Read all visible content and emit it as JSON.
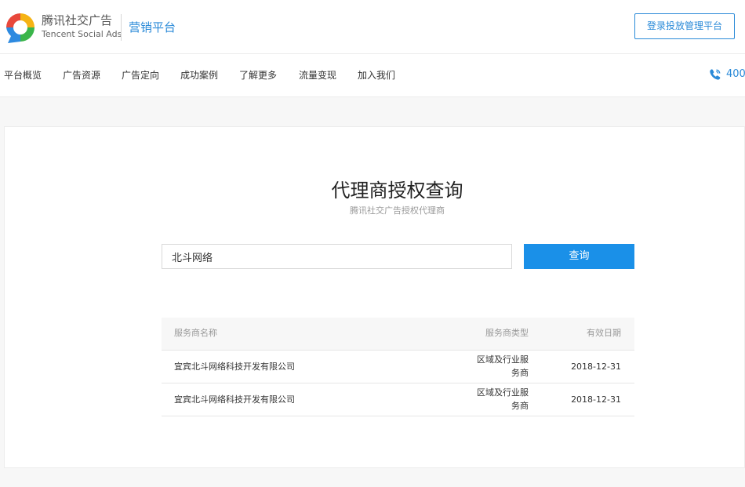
{
  "header": {
    "brand_cn": "腾讯社交广告",
    "brand_en": "Tencent Social Ads",
    "platform": "营销平台",
    "login_button": "登录投放管理平台"
  },
  "nav": {
    "items": [
      "平台概览",
      "广告资源",
      "广告定向",
      "成功案例",
      "了解更多",
      "流量变现",
      "加入我们"
    ],
    "phone": "400-"
  },
  "main": {
    "title": "代理商授权查询",
    "subtitle": "腾讯社交广告授权代理商",
    "search": {
      "value": "北斗网络",
      "placeholder": ""
    },
    "search_button": "查询",
    "table": {
      "headers": {
        "name": "服务商名称",
        "type": "服务商类型",
        "date": "有效日期"
      },
      "rows": [
        {
          "name": "宜宾北斗网络科技开发有限公司",
          "type_line1": "区域及行业服",
          "type_line2": "务商",
          "date": "2018-12-31"
        },
        {
          "name": "宜宾北斗网络科技开发有限公司",
          "type_line1": "区域及行业服",
          "type_line2": "务商",
          "date": "2018-12-31"
        }
      ]
    }
  },
  "colors": {
    "accent": "#2a8ad8",
    "button_blue": "#1a90e8",
    "logo_red": "#e8483b",
    "logo_blue": "#2d8ae0",
    "logo_green": "#3ab54a",
    "logo_yellow": "#f5b314"
  },
  "icons": {
    "logo": "tencent-social-ads-logo",
    "phone": "phone-icon"
  }
}
